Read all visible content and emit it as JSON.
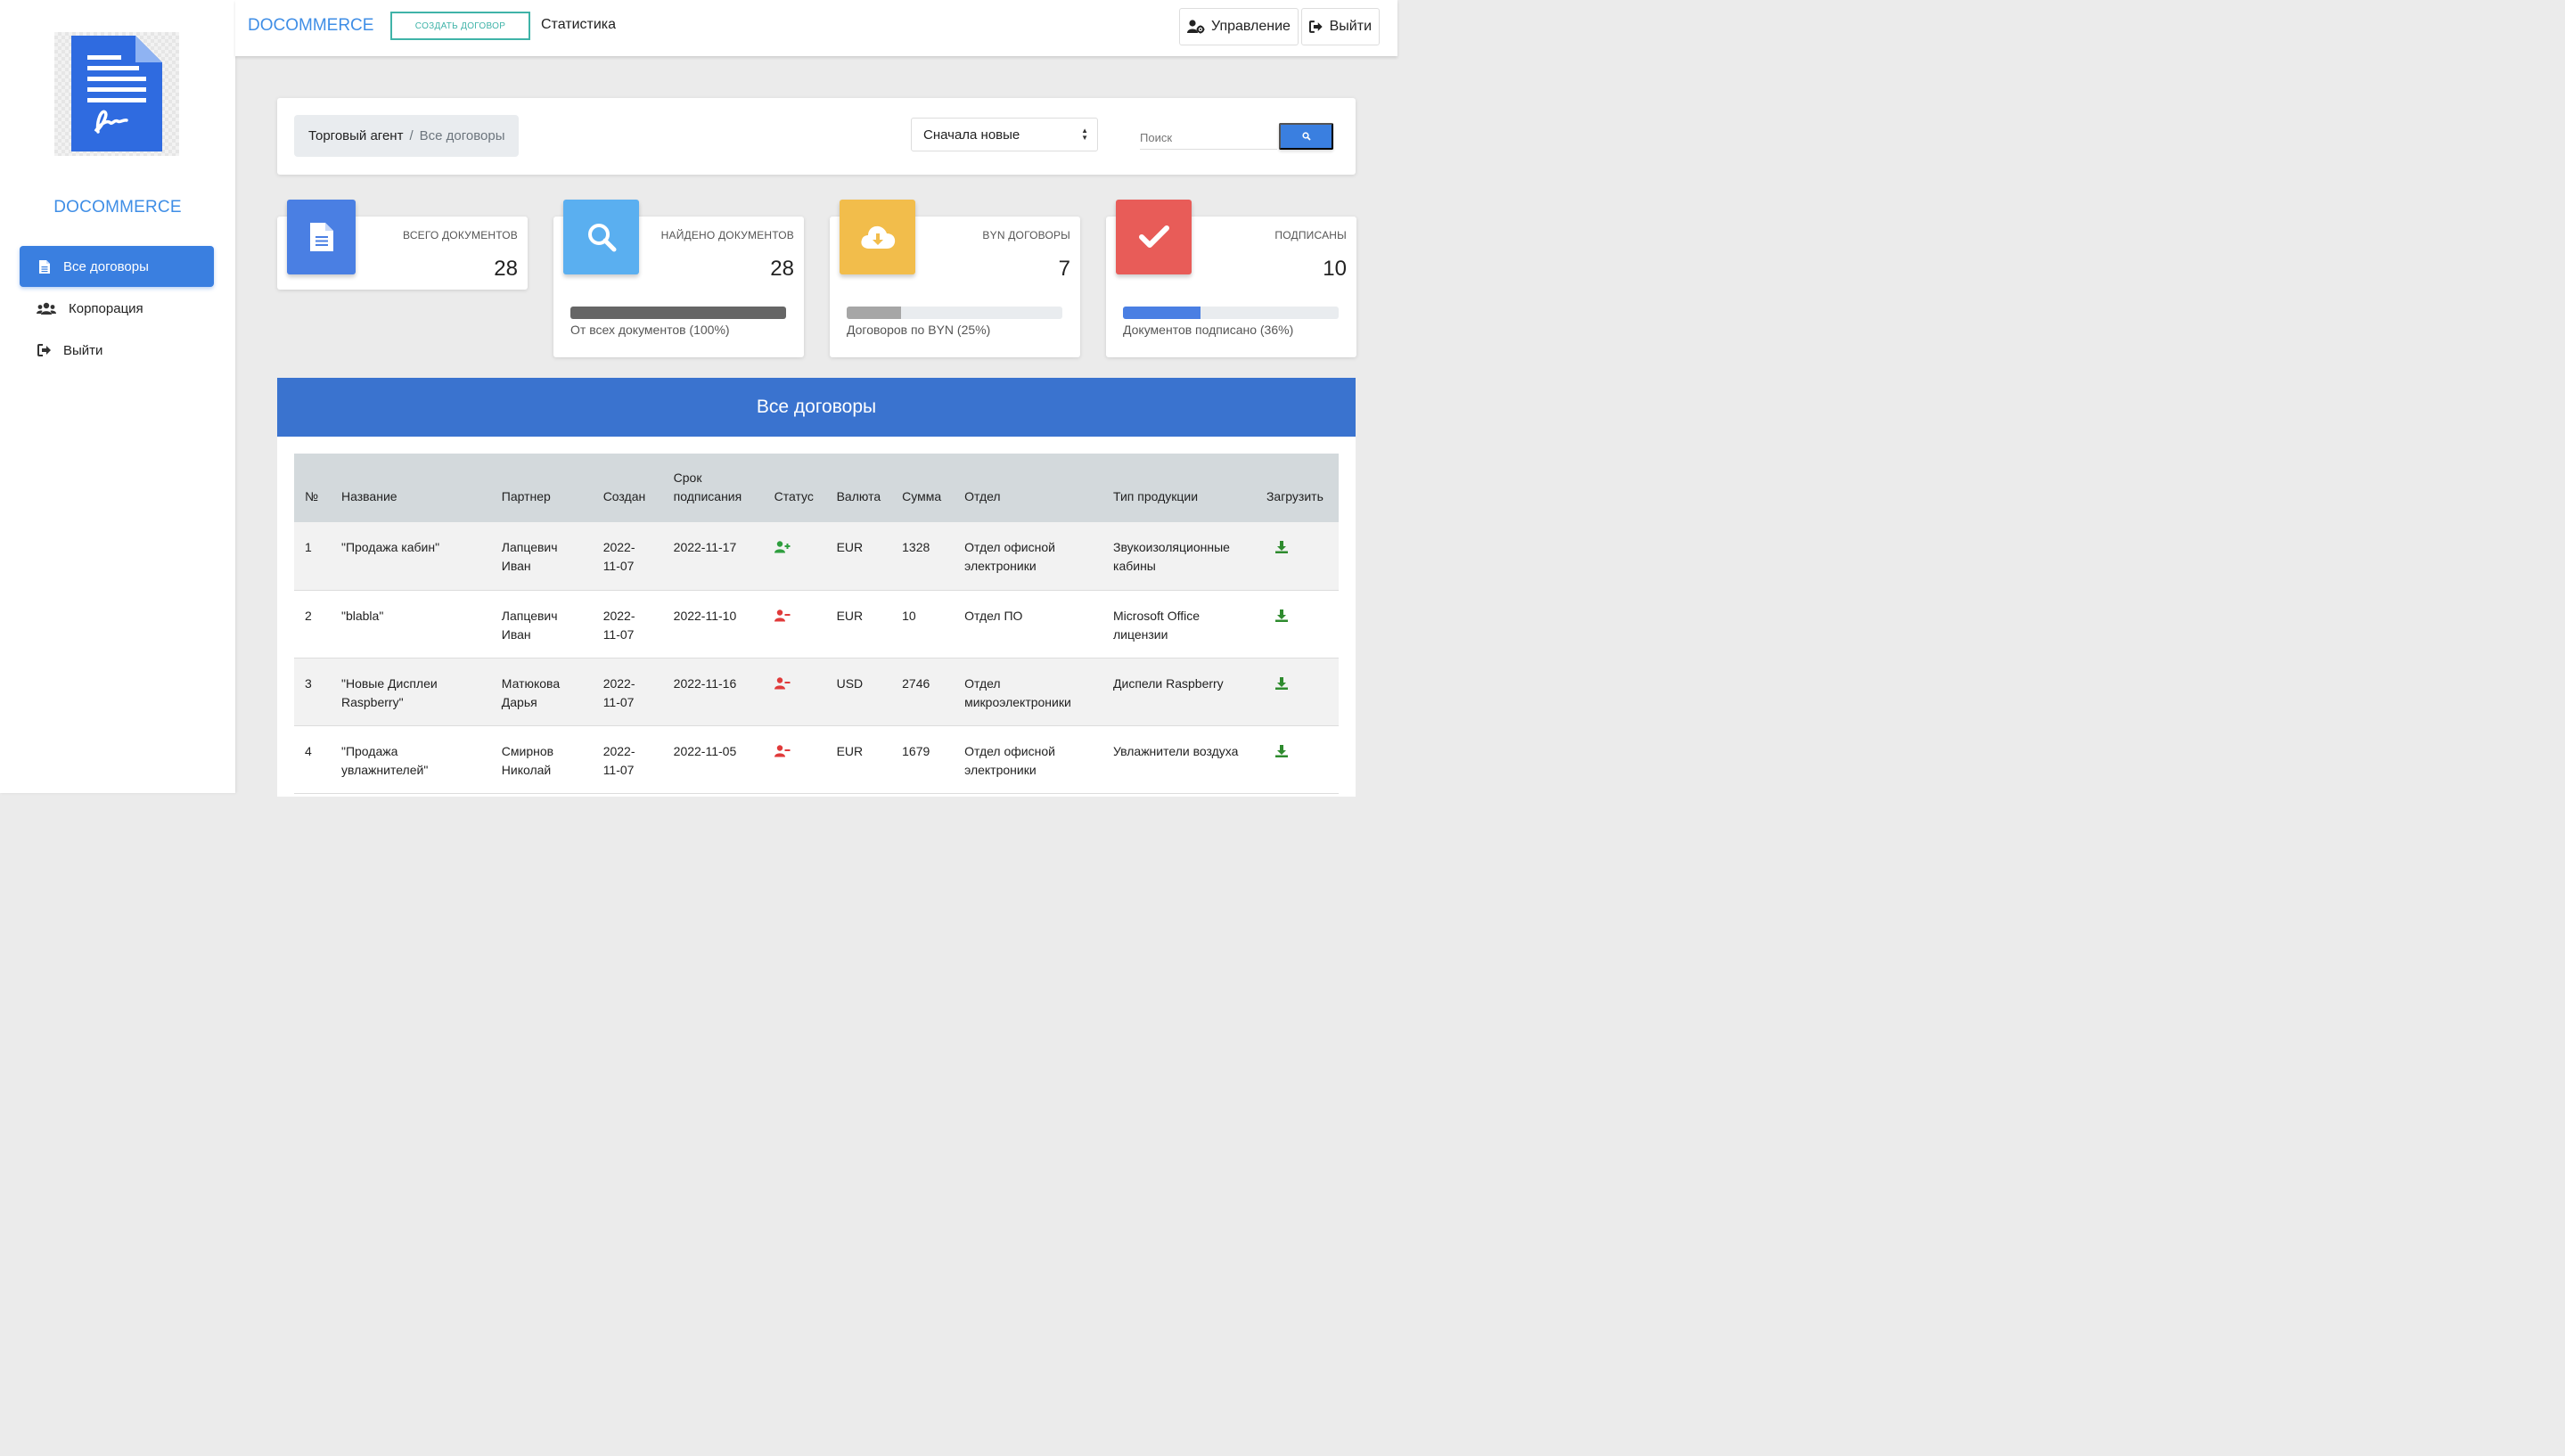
{
  "sidebar": {
    "brand": "DOCOMMERCE",
    "items": [
      {
        "label": "Все договоры",
        "icon": "file-icon",
        "active": true
      },
      {
        "label": "Корпорация",
        "icon": "users-icon"
      },
      {
        "label": "Выйти",
        "icon": "sign-out-icon"
      }
    ]
  },
  "topbar": {
    "brand": "DOCOMMERCE",
    "create_label": "СОЗДАТЬ ДОГОВОР",
    "stats_label": "Статистика",
    "manage_label": "Управление",
    "exit_label": "Выйти"
  },
  "filter": {
    "breadcrumb": [
      "Торговый агент",
      "Все договоры"
    ],
    "sort_value": "Сначала новые",
    "search_placeholder": "Поиск"
  },
  "stats": [
    {
      "label": "ВСЕГО ДОКУМЕНТОВ",
      "value": "28",
      "icon": "document-icon",
      "color": "#4a7fe3"
    },
    {
      "label": "НАЙДЕНО ДОКУМЕНТОВ",
      "value": "28",
      "icon": "search-icon",
      "color": "#5aaff0",
      "progress": 1.0,
      "progress_color": "#666666",
      "note": "От всех документов (100%)"
    },
    {
      "label": "BYN ДОГОВОРЫ",
      "value": "7",
      "icon": "cloud-download-icon",
      "color": "#f2bd4b",
      "progress": 0.25,
      "progress_color": "#a6a6a6",
      "note": "Договоров по BYN (25%)"
    },
    {
      "label": "ПОДПИСАНЫ",
      "value": "10",
      "icon": "check-icon",
      "color": "#e85c58",
      "progress": 0.36,
      "progress_color": "#4a7fe3",
      "note": "Документов подписано (36%)"
    }
  ],
  "table": {
    "title": "Все договоры",
    "columns": [
      "№",
      "Название",
      "Партнер",
      "Создан",
      "Срок подписания",
      "Статус",
      "Валюта",
      "Сумма",
      "Отдел",
      "Тип продукции",
      "Загрузить"
    ],
    "rows": [
      {
        "no": "1",
        "name": "\"Продажа кабин\"",
        "partner": "Лапцевич Иван",
        "created": "2022-11-07",
        "deadline": "2022-11-17",
        "status": "signed",
        "currency": "EUR",
        "sum": "1328",
        "dept": "Отдел офисной электроники",
        "product": "Звукоизоляционные кабины"
      },
      {
        "no": "2",
        "name": "\"blabla\"",
        "partner": "Лапцевич Иван",
        "created": "2022-11-07",
        "deadline": "2022-11-10",
        "status": "unsigned",
        "currency": "EUR",
        "sum": "10",
        "dept": "Отдел ПО",
        "product": "Microsoft Office лицензии"
      },
      {
        "no": "3",
        "name": "\"Новые Дисплеи Raspberry\"",
        "partner": "Матюкова Дарья",
        "created": "2022-11-07",
        "deadline": "2022-11-16",
        "status": "unsigned",
        "currency": "USD",
        "sum": "2746",
        "dept": "Отдел микроэлектроники",
        "product": "Диспели Raspberry"
      },
      {
        "no": "4",
        "name": "\"Продажа увлажнителей\"",
        "partner": "Смирнов Николай",
        "created": "2022-11-07",
        "deadline": "2022-11-05",
        "status": "unsigned",
        "currency": "EUR",
        "sum": "1679",
        "dept": "Отдел офисной электроники",
        "product": "Увлажнители воздуха"
      }
    ]
  },
  "colors": {
    "accent": "#3a7fe0",
    "brand": "#3f8ee6",
    "teal": "#3fb3a8",
    "status_signed": "#2e9e3e",
    "status_unsigned": "#e03a3a",
    "download": "#2e8b2e"
  }
}
